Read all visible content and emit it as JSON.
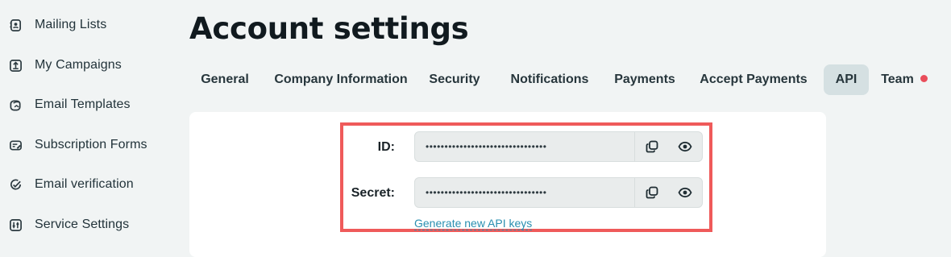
{
  "sidebar": {
    "items": [
      {
        "label": "Mailing Lists",
        "icon": "contact-card-icon"
      },
      {
        "label": "My Campaigns",
        "icon": "upload-box-icon"
      },
      {
        "label": "Email Templates",
        "icon": "templates-icon"
      },
      {
        "label": "Subscription Forms",
        "icon": "form-edit-icon"
      },
      {
        "label": "Email verification",
        "icon": "check-circle-icon"
      },
      {
        "label": "Service Settings",
        "icon": "sliders-icon"
      }
    ]
  },
  "page": {
    "title": "Account settings"
  },
  "tabs": [
    {
      "label": "General"
    },
    {
      "label": "Company Information"
    },
    {
      "label": "Security"
    },
    {
      "label": "Notifications"
    },
    {
      "label": "Payments"
    },
    {
      "label": "Accept Payments"
    },
    {
      "label": "API",
      "active": true
    },
    {
      "label": "Team",
      "badge": "red-dot"
    }
  ],
  "api": {
    "id_label": "ID:",
    "id_value": "••••••••••••••••••••••••••••••••",
    "secret_label": "Secret:",
    "secret_value": "••••••••••••••••••••••••••••••••",
    "generate_link": "Generate new API keys"
  },
  "colors": {
    "background": "#f1f4f4",
    "active_tab": "#d5e0e2",
    "highlight_border": "#ef5a5a",
    "link": "#2a8fb0",
    "badge": "#e94d5a"
  }
}
